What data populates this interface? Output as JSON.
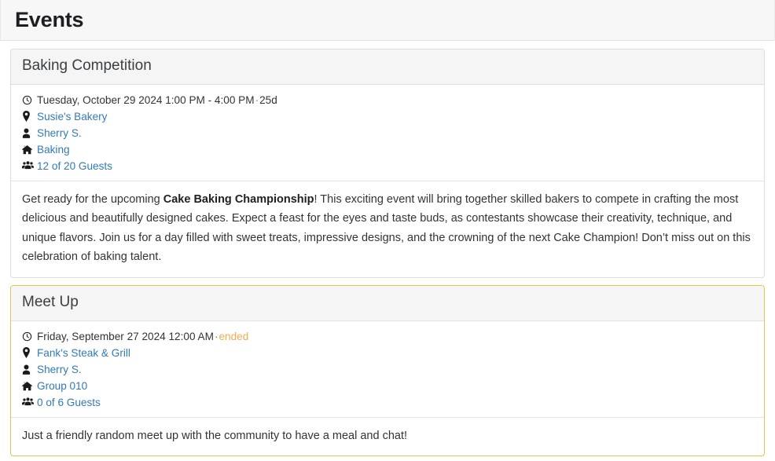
{
  "header": {
    "title": "Events"
  },
  "icons": {
    "clock": "clock-icon",
    "location": "map-marker-icon",
    "host": "user-icon",
    "group": "home-icon",
    "guests": "users-icon"
  },
  "events": [
    {
      "title": "Baking Competition",
      "highlight": false,
      "datetime": "Tuesday, October 29 2024 1:00 PM - 4:00 PM",
      "separator": "·",
      "countdown": "25d",
      "countdown_is_ended": false,
      "location": "Susie's Bakery",
      "host": "Sherry S.",
      "group": "Baking",
      "guests": "12 of 20 Guests",
      "description_before": "Get ready for the upcoming ",
      "description_bold": "Cake Baking Championship",
      "description_after": "! This exciting event will bring together skilled bakers to compete in crafting the most delicious and beautifully designed cakes. Expect a feast for the eyes and taste buds, as contestants showcase their creativity, technique, and unique flavors. Join us for a day filled with sweet treats, impressive designs, and the crowning of the next Cake Champion! Don’t miss out on this celebration of baking talent."
    },
    {
      "title": "Meet Up",
      "highlight": true,
      "datetime": "Friday, September 27 2024 12:00 AM",
      "separator": "·",
      "countdown": "ended",
      "countdown_is_ended": true,
      "location": "Fank's Steak & Grill",
      "host": "Sherry S.",
      "group": "Group 010",
      "guests": "0 of 6 Guests",
      "description_before": "Just a friendly random meet up with the community to have a meal and chat!",
      "description_bold": "",
      "description_after": ""
    }
  ],
  "colors": {
    "link": "#337ab7",
    "warning": "#f0ad4e",
    "highlight_border": "#e8c547",
    "panel_border": "#dddddd",
    "heading_bg": "#f5f5f5"
  }
}
